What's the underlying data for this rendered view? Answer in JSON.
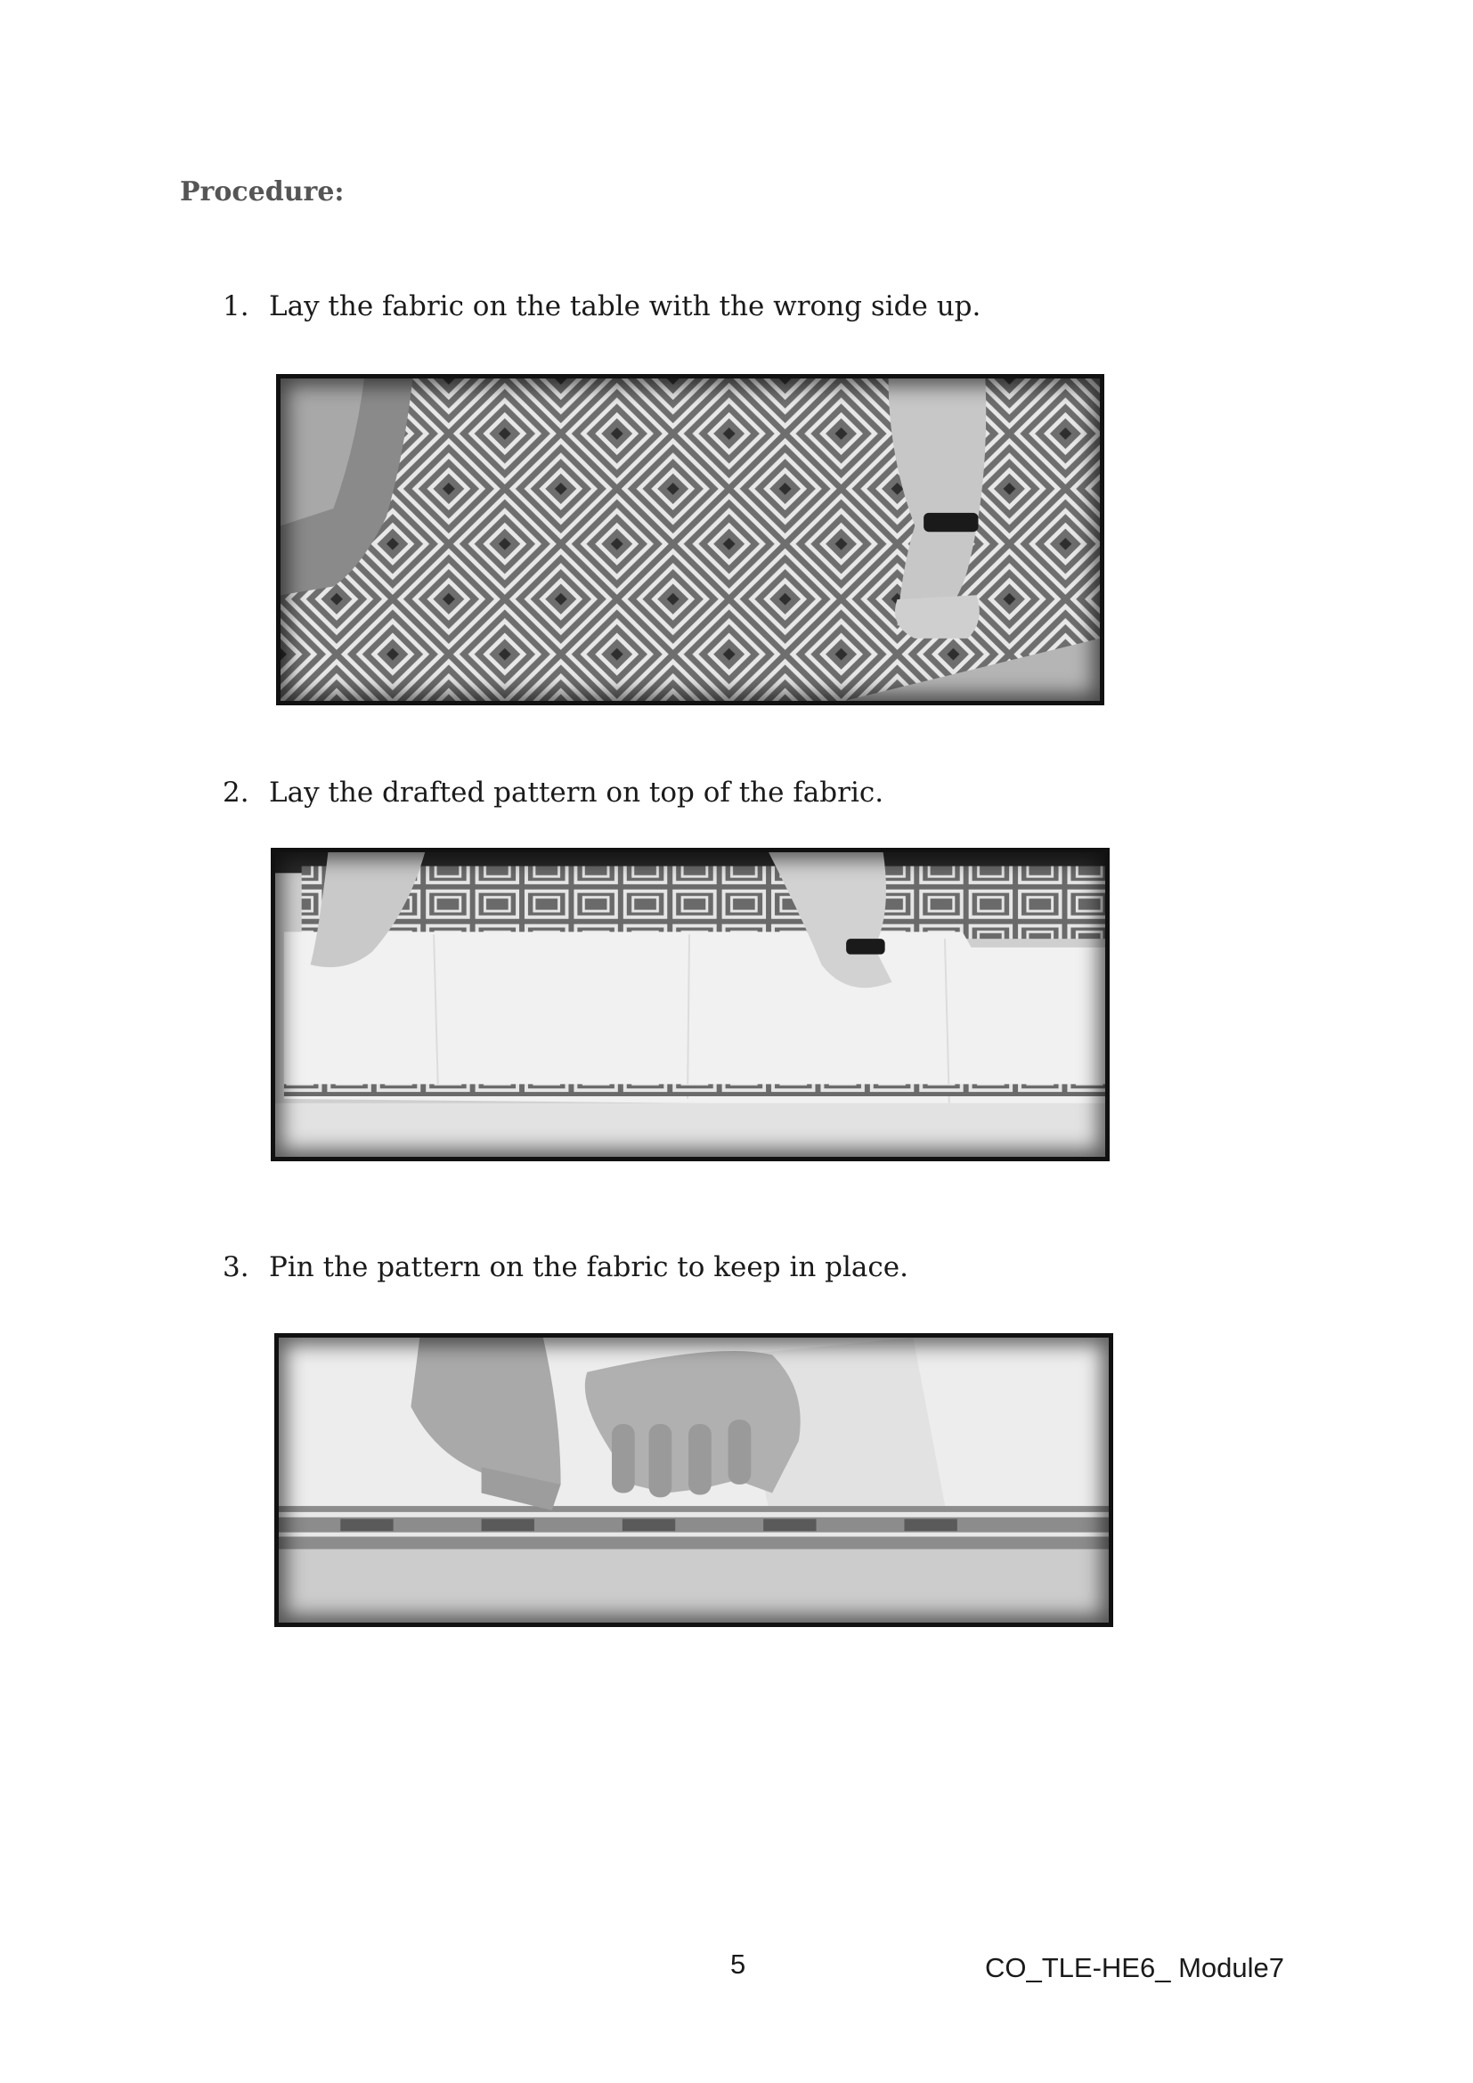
{
  "heading": "Procedure:",
  "steps": [
    {
      "number": "1.",
      "text": "Lay the fabric on the table with the wrong side up."
    },
    {
      "number": "2.",
      "text": "Lay the drafted pattern on top of the fabric."
    },
    {
      "number": "3.",
      "text": "Pin the pattern on the fabric to keep in place."
    }
  ],
  "footer": {
    "page_number": "5",
    "module_code": "CO_TLE-HE6_ Module7"
  }
}
